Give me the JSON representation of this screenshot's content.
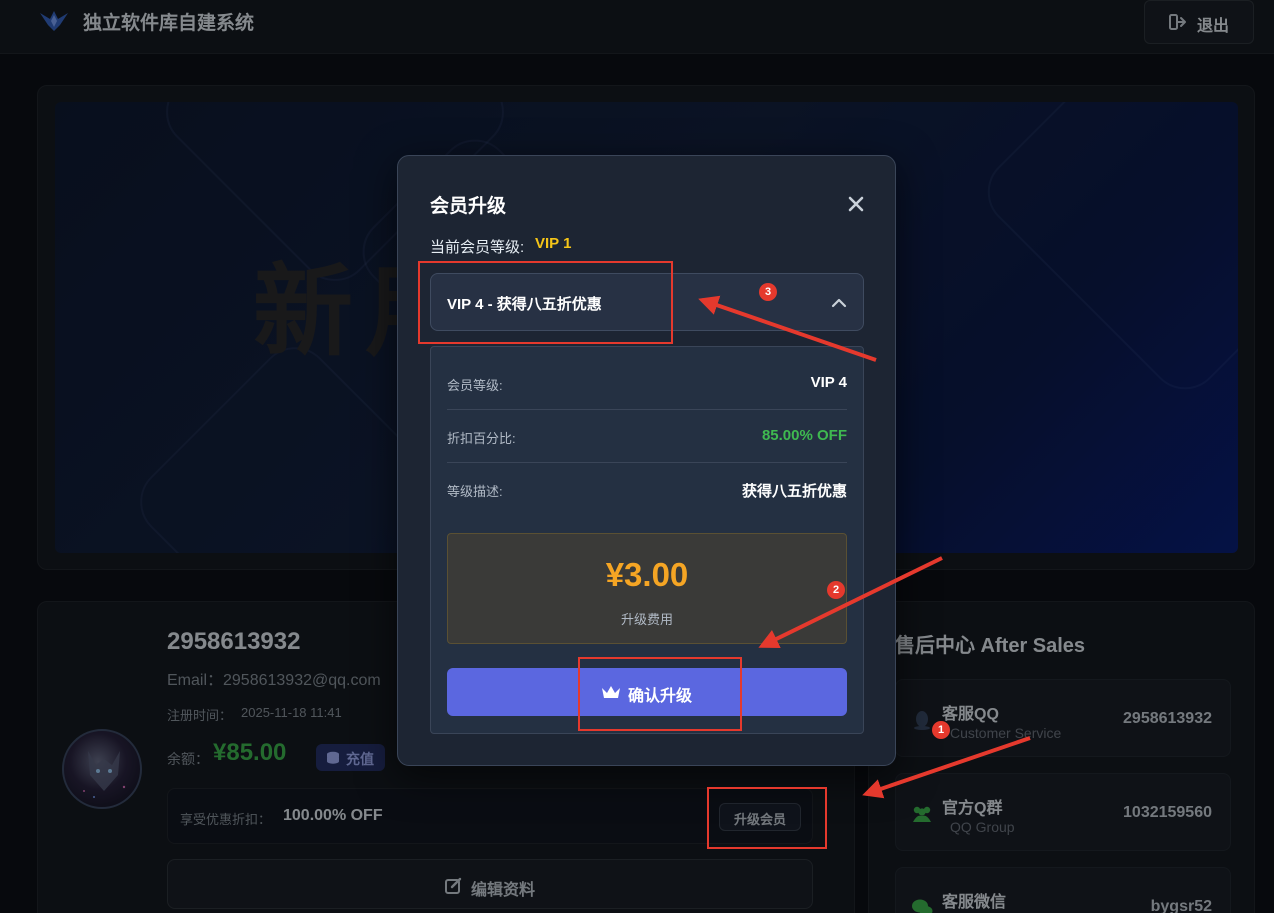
{
  "header": {
    "app_title": "独立软件库自建系统",
    "logout_label": "退出",
    "logo_icon": "bird-logo-icon",
    "logout_icon": "sign-out-icon"
  },
  "banner": {
    "text": "新用户教程"
  },
  "profile": {
    "username": "2958613932",
    "email": "Email：2958613932@qq.com",
    "register_label": "注册时间：",
    "register_time": "2025-11-18 11:41",
    "balance_label": "余额：",
    "balance_value": "¥85.00",
    "recharge_label": "充值",
    "discount_label": "享受优惠折扣：",
    "discount_value": "100.00% OFF",
    "upgrade_label": "升级会员",
    "edit_label": "编辑资料"
  },
  "after_sales": {
    "title": "售后中心 After Sales",
    "contacts": [
      {
        "title": "客服QQ",
        "subtitle": "Customer Service",
        "value": "2958613932",
        "icon": "qq-icon"
      },
      {
        "title": "官方Q群",
        "subtitle": "QQ Group",
        "value": "1032159560",
        "icon": "users-icon"
      },
      {
        "title": "客服微信",
        "subtitle": "",
        "value": "bygsr52",
        "icon": "wechat-icon"
      }
    ]
  },
  "modal": {
    "title": "会员升级",
    "current_level_label": "当前会员等级:",
    "current_level_value": "VIP 1",
    "selected_option": "VIP 4 - 获得八五折优惠",
    "details": [
      {
        "label": "会员等级:",
        "value": "VIP 4"
      },
      {
        "label": "折扣百分比:",
        "value": "85.00% OFF"
      },
      {
        "label": "等级描述:",
        "value": "获得八五折优惠"
      }
    ],
    "price": "¥3.00",
    "price_label": "升级费用",
    "confirm_label": "确认升级",
    "confirm_icon": "crown-icon"
  },
  "annotations": {
    "markers": [
      "1",
      "2",
      "3"
    ],
    "color": "#e5392d"
  },
  "colors": {
    "accent": "#5b67e0",
    "price": "#f5a524",
    "vip_gold": "#f5c518",
    "success_green": "#3fb950"
  }
}
